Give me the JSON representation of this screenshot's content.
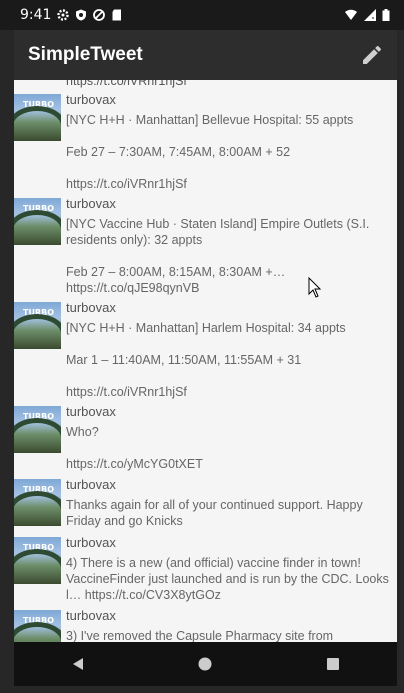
{
  "status_bar": {
    "time": "9:41",
    "left_icons": [
      "settings-icon",
      "shield-icon",
      "do-not-disturb-icon",
      "sd-card-icon"
    ],
    "right_icons": [
      "wifi-icon",
      "signal-icon",
      "battery-icon"
    ]
  },
  "app_bar": {
    "title": "SimpleTweet",
    "compose_icon": "pencil-icon"
  },
  "timeline": {
    "partial_top_text": "https://t.co/iVRnr1hjSf",
    "tweets": [
      {
        "handle": "turbovax",
        "text": "[NYC H+H · Manhattan] Bellevue Hospital: 55 appts\n\nFeb 27 – 7:30AM, 7:45AM, 8:00AM + 52\n\nhttps://t.co/iVRnr1hjSf"
      },
      {
        "handle": "turbovax",
        "text": "[NYC Vaccine Hub · Staten Island] Empire Outlets (S.I. residents only): 32 appts\n\nFeb 27 – 8:00AM, 8:15AM, 8:30AM +…\nhttps://t.co/qJE98qynVB"
      },
      {
        "handle": "turbovax",
        "text": "[NYC H+H · Manhattan] Harlem Hospital: 34 appts\n\nMar 1 – 11:40AM, 11:50AM, 11:55AM + 31\n\nhttps://t.co/iVRnr1hjSf"
      },
      {
        "handle": "turbovax",
        "text": "Who?\n\nhttps://t.co/yMcYG0tXET"
      },
      {
        "handle": "turbovax",
        "text": "Thanks again for all of your continued support. Happy Friday and go Knicks"
      },
      {
        "handle": "turbovax",
        "text": "4) There is a new (and official) vaccine finder in town! VaccineFinder just launched and is run by the CDC. Looks l… https://t.co/CV3X8ytGOz"
      },
      {
        "handle": "turbovax",
        "text": "3) I've removed the Capsule Pharmacy site from"
      }
    ]
  },
  "nav_bar": {
    "buttons": [
      "back-icon",
      "home-icon",
      "recents-icon"
    ]
  }
}
